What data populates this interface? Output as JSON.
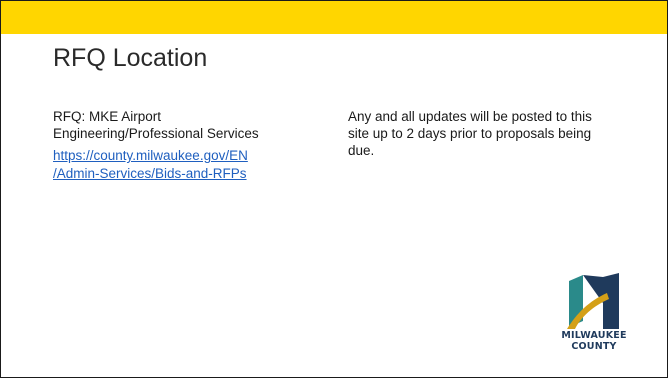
{
  "slide": {
    "title": "RFQ Location",
    "rfq_line1": "RFQ: MKE Airport",
    "rfq_line2": "Engineering/Professional Services",
    "link_line1": "https://county.milwaukee.gov/EN",
    "link_line2": "/Admin-Services/Bids-and-RFPs",
    "note": "Any and all updates will be posted to this site up to 2 days prior to proposals being due."
  },
  "logo": {
    "line1": "MILWAUKEE",
    "line2": "COUNTY"
  },
  "colors": {
    "accent_bar": "#ffd600",
    "link": "#1f5fbf",
    "logo_navy": "#1f3a5c",
    "logo_teal": "#2a8a8a",
    "logo_gold": "#d4a017"
  }
}
